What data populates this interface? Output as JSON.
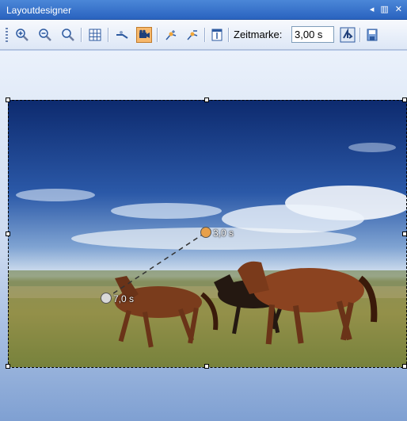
{
  "window": {
    "title": "Layoutdesigner",
    "pin_icon": "pin-icon",
    "close_icon": "close-icon",
    "menu_icon": "chevron-left-icon"
  },
  "toolbar": {
    "buttons": [
      {
        "name": "zoom-in-button",
        "icon": "zoom-in-icon"
      },
      {
        "name": "zoom-out-button",
        "icon": "zoom-out-icon"
      },
      {
        "name": "zoom-fit-button",
        "icon": "zoom-fit-icon"
      },
      {
        "name": "grid-button",
        "icon": "grid-icon"
      },
      {
        "name": "path-tool-button",
        "icon": "path-icon"
      },
      {
        "name": "camera-button",
        "icon": "camera-icon"
      },
      {
        "name": "add-keyframe-button",
        "icon": "add-keyframe-icon"
      },
      {
        "name": "remove-keyframe-button",
        "icon": "remove-keyframe-icon"
      },
      {
        "name": "properties-button",
        "icon": "properties-icon"
      },
      {
        "name": "apply-time-button",
        "icon": "time-apply-icon"
      },
      {
        "name": "save-button",
        "icon": "save-icon"
      }
    ],
    "zeitmarke_label": "Zeitmarke:",
    "zeitmarke_value": "3,00 s"
  },
  "canvas": {
    "keyframes": [
      {
        "label": "3,0 s",
        "color": "#e8a04a"
      },
      {
        "label": "7,0 s",
        "color": "#d9d9d9"
      }
    ]
  }
}
